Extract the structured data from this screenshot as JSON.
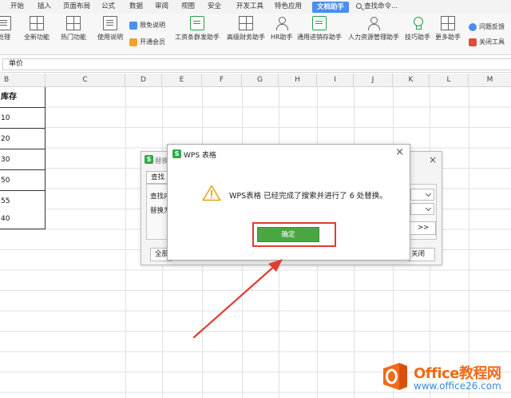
{
  "menu": {
    "tabs": [
      "开始",
      "插入",
      "页面布局",
      "公式",
      "数据",
      "审阅",
      "视图",
      "安全",
      "开发工具",
      "特色应用",
      "文档助手"
    ],
    "active_tab": "文档助手",
    "search": "查找命令..."
  },
  "ribbon": {
    "items": [
      "处理",
      "全新功能",
      "热门功能",
      "使用说明",
      "工资条群发助手",
      "高级财务助手",
      "HR助手",
      "通用进销存助手",
      "人力资源管理助手",
      "技巧助手",
      "更多助手"
    ],
    "limited_free": "限免说明",
    "open_member": "开通会员",
    "feedback": "问题反馈",
    "close_tool": "关闭工具"
  },
  "formula_bar": {
    "value": "单价"
  },
  "columns": [
    "B",
    "C",
    "D",
    "E",
    "F",
    "G",
    "H",
    "I",
    "J",
    "K",
    "L",
    "M"
  ],
  "column_b": [
    "库存",
    "10",
    "20",
    "30",
    "50",
    "55",
    "40"
  ],
  "replace_dialog": {
    "title": "替换",
    "tab": "查找",
    "find_label": "查找内",
    "replace_label": "替换为",
    "more_button": ">>",
    "replace_all": "全部",
    "close": "关闭"
  },
  "message_box": {
    "title": "WPS 表格",
    "message": "WPS表格 已经完成了搜索并进行了 6 处替换。",
    "ok": "确定",
    "close_glyph": "×"
  },
  "watermark": {
    "title": "Office教程网",
    "url": "www.office26.com"
  },
  "colors": {
    "accent_tab": "#4a8ef0",
    "ok_button": "#48a741",
    "highlight": "#e23b32",
    "arrow": "#e23b32"
  }
}
